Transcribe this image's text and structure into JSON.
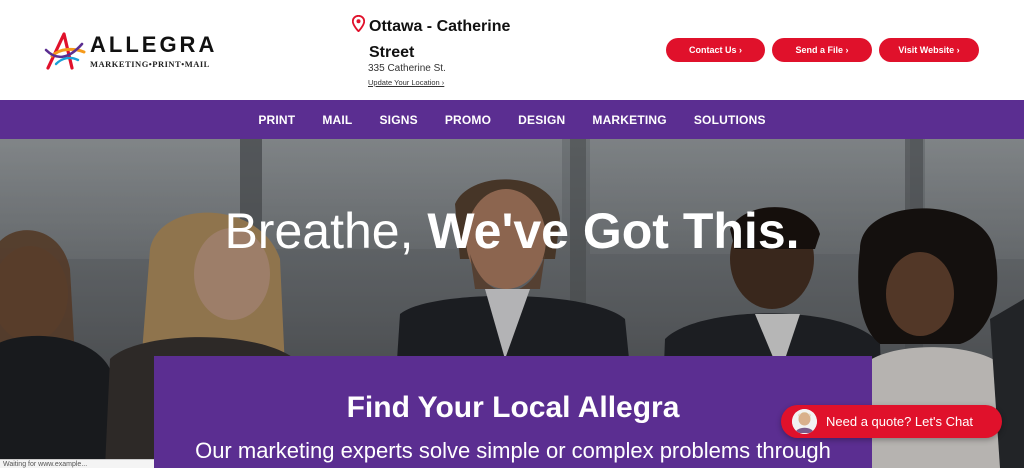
{
  "header": {
    "logo": {
      "wordmark": "ALLEGRA",
      "tagline": "MARKETING•PRINT•MAIL"
    },
    "location": {
      "name": "Ottawa - Catherine Street",
      "address": "335 Catherine St.",
      "update_link": "Update Your Location ›",
      "icon": "map-pin-icon"
    },
    "actions": [
      {
        "label": "Contact Us ›"
      },
      {
        "label": "Send a File ›"
      },
      {
        "label": "Visit Website ›"
      }
    ]
  },
  "nav": {
    "items": [
      "PRINT",
      "MAIL",
      "SIGNS",
      "PROMO",
      "DESIGN",
      "MARKETING",
      "SOLUTIONS"
    ]
  },
  "hero": {
    "headline_light": "Breathe,",
    "headline_bold": "We've Got This."
  },
  "local_card": {
    "title": "Find Your Local Allegra",
    "description": "Our marketing experts solve simple or complex problems through"
  },
  "status_bar": {
    "text": "Waiting for www.example..."
  },
  "chat": {
    "label": "Need a quote? Let's Chat"
  },
  "colors": {
    "brand_purple": "#5b2e91",
    "brand_red": "#e0112b",
    "white": "#ffffff"
  }
}
